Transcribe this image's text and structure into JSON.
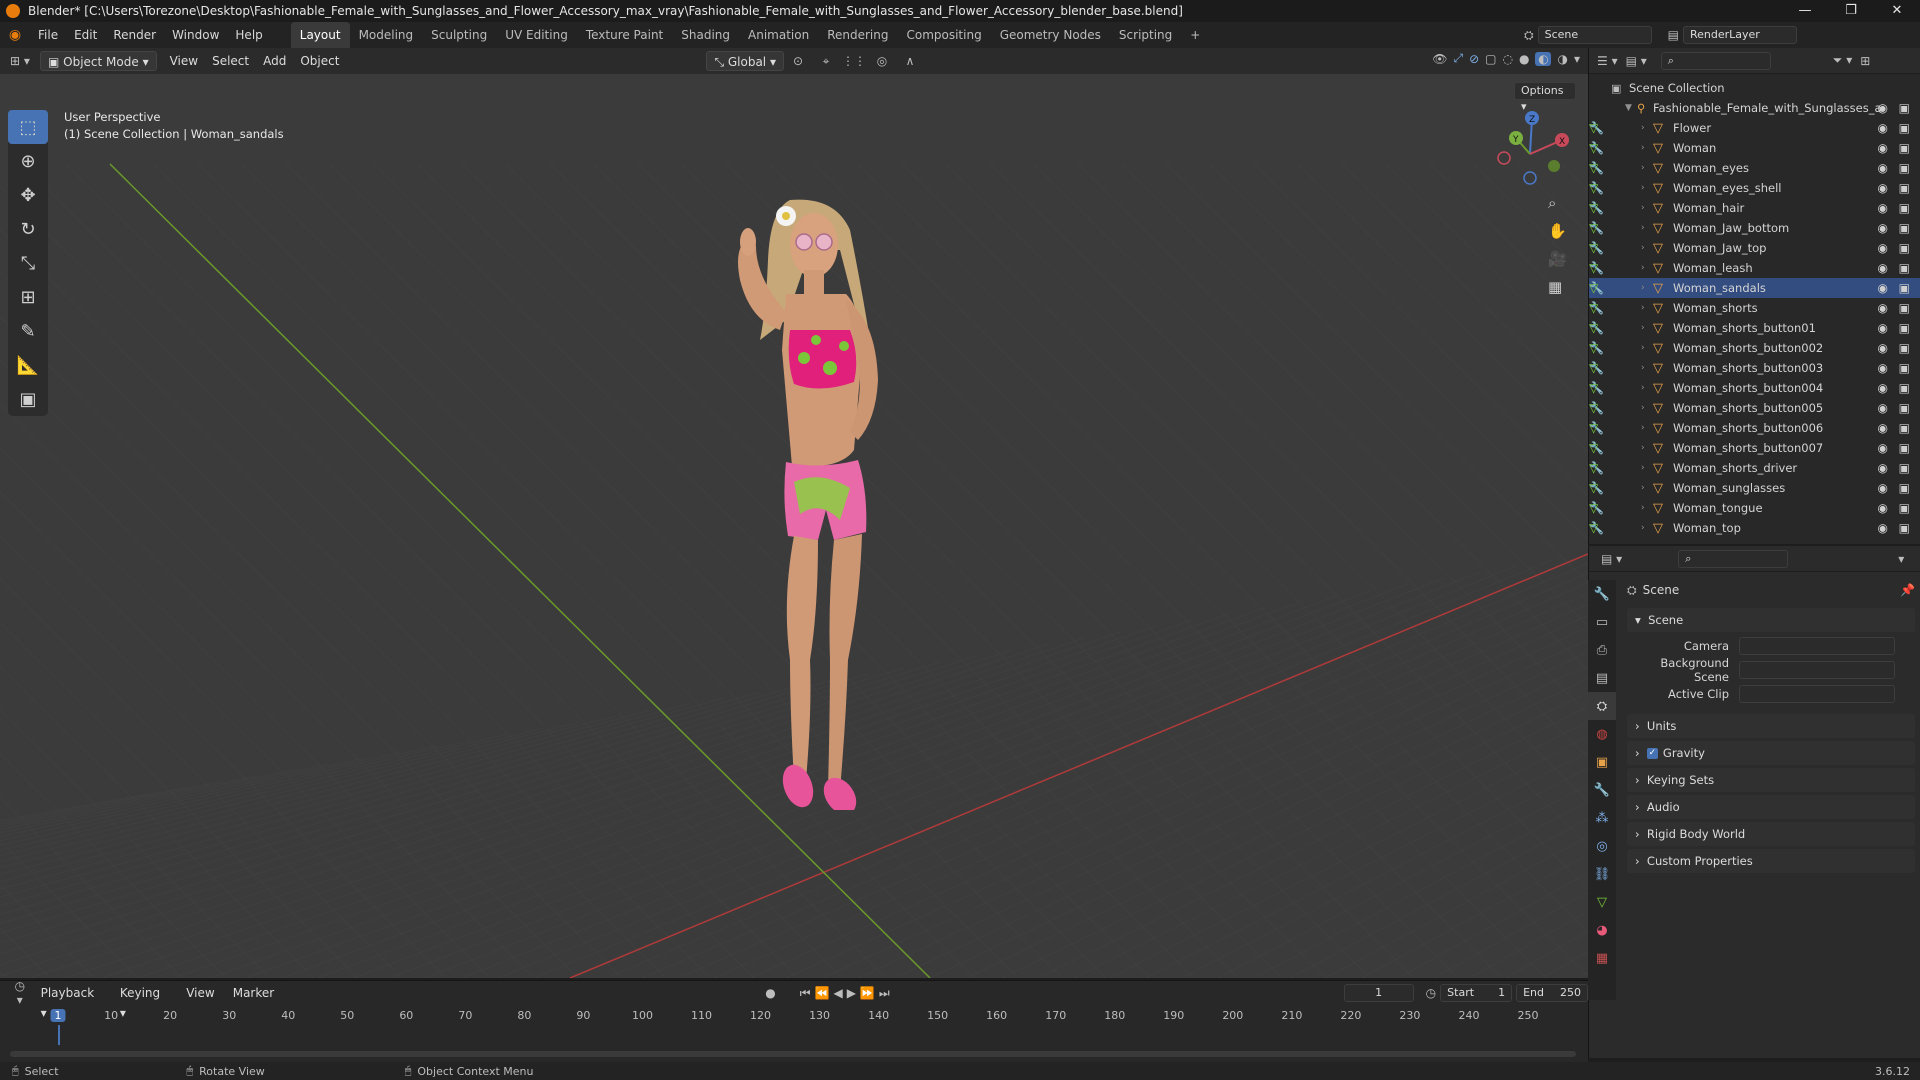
{
  "window": {
    "title": "Blender* [C:\\Users\\Torezone\\Desktop\\Fashionable_Female_with_Sunglasses_and_Flower_Accessory_max_vray\\Fashionable_Female_with_Sunglasses_and_Flower_Accessory_blender_base.blend]",
    "controls": [
      "—",
      "❐",
      "✕"
    ]
  },
  "menu": {
    "items": [
      "File",
      "Edit",
      "Render",
      "Window",
      "Help"
    ],
    "workspaces": [
      "Layout",
      "Modeling",
      "Sculpting",
      "UV Editing",
      "Texture Paint",
      "Shading",
      "Animation",
      "Rendering",
      "Compositing",
      "Geometry Nodes",
      "Scripting"
    ],
    "active_workspace": "Layout",
    "add_workspace": "+",
    "scene": "Scene",
    "render_layer": "RenderLayer"
  },
  "viewport_header": {
    "mode": "Object Mode",
    "menus": [
      "View",
      "Select",
      "Add",
      "Object"
    ],
    "orientation": "Global",
    "options": "Options"
  },
  "viewport": {
    "perspective": "User Perspective",
    "context": "(1) Scene Collection | Woman_sandals",
    "gizmo_axes": [
      "Z",
      "Y",
      "X"
    ]
  },
  "outliner": {
    "root": "Scene Collection",
    "collection": "Fashionable_Female_with_Sunglasses_a",
    "items": [
      "Flower",
      "Woman",
      "Woman_eyes",
      "Woman_eyes_shell",
      "Woman_hair",
      "Woman_Jaw_bottom",
      "Woman_Jaw_top",
      "Woman_leash",
      "Woman_sandals",
      "Woman_shorts",
      "Woman_shorts_button01",
      "Woman_shorts_button002",
      "Woman_shorts_button003",
      "Woman_shorts_button004",
      "Woman_shorts_button005",
      "Woman_shorts_button006",
      "Woman_shorts_button007",
      "Woman_shorts_driver",
      "Woman_sunglasses",
      "Woman_tongue",
      "Woman_top"
    ],
    "selected": "Woman_sandals"
  },
  "properties": {
    "header": "Scene",
    "section": "Scene",
    "fields": [
      {
        "label": "Camera",
        "value": ""
      },
      {
        "label": "Background Scene",
        "value": ""
      },
      {
        "label": "Active Clip",
        "value": ""
      }
    ],
    "panels": [
      "Units",
      "Gravity",
      "Keying Sets",
      "Audio",
      "Rigid Body World",
      "Custom Properties"
    ],
    "gravity_checked": true
  },
  "timeline": {
    "menus": [
      "Playback",
      "Keying",
      "View",
      "Marker"
    ],
    "current_frame": "1",
    "start_label": "Start",
    "start": "1",
    "end_label": "End",
    "end": "250",
    "ticks": [
      "1",
      "10",
      "20",
      "30",
      "40",
      "50",
      "60",
      "70",
      "80",
      "90",
      "100",
      "110",
      "120",
      "130",
      "140",
      "150",
      "160",
      "170",
      "180",
      "190",
      "200",
      "210",
      "220",
      "230",
      "240",
      "250"
    ]
  },
  "statusbar": {
    "select": "Select",
    "rotate": "Rotate View",
    "context_menu": "Object Context Menu",
    "version": "3.6.12"
  },
  "colors": {
    "accent": "#4772b3",
    "object_orange": "#e8a24a",
    "axis_red": "#b03a3a",
    "axis_green": "#6a9a2a"
  }
}
